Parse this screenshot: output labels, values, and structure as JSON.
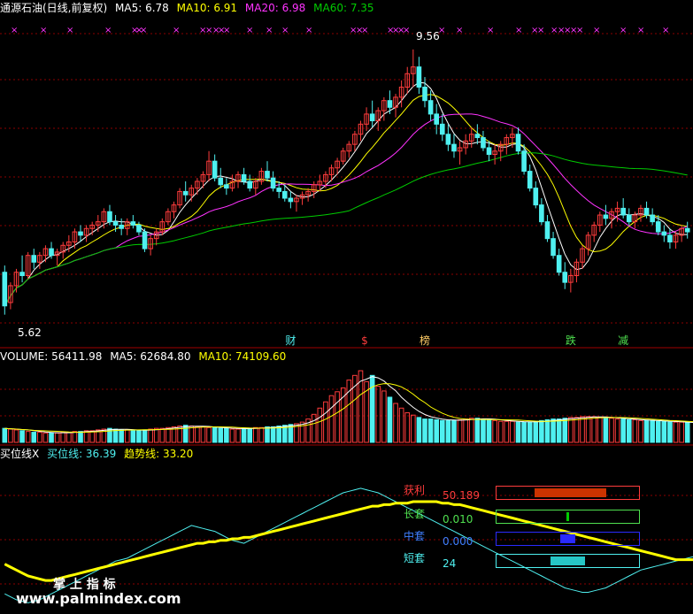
{
  "colors": {
    "up": "#ff3c3c",
    "down": "#4ff0f0",
    "ma5": "#ffffff",
    "ma10": "#ffff00",
    "ma20": "#ff33ff",
    "ma60": "#00cc00",
    "grid": "#8b0000",
    "divider": "#a00000",
    "xmark": "#ff33ff"
  },
  "price_panel": {
    "title": "通源石油(日线,前复权)",
    "ma5_label": "MA5: 6.78",
    "ma10_label": "MA10: 6.91",
    "ma20_label": "MA20: 6.98",
    "ma60_label": "MA60: 7.35",
    "high_label": "9.56",
    "low_label": "5.62"
  },
  "volume_panel": {
    "volume_label": "VOLUME: 56411.98",
    "ma5_label": "MA5: 62684.80",
    "ma10_label": "MA10: 74109.60"
  },
  "indicator_panel": {
    "name": "买位线X",
    "buy_label": "买位线: 36.39",
    "trend_label": "趋势线: 33.20"
  },
  "signal_markers": [
    {
      "text": "财",
      "color": "#4ff0f0",
      "x_index": 49
    },
    {
      "text": "$",
      "color": "#ff3c3c",
      "x_index": 62
    },
    {
      "text": "榜",
      "color": "#ffcc66",
      "x_index": 72
    },
    {
      "text": "跌",
      "color": "#4fe04f",
      "x_index": 97
    },
    {
      "text": "减",
      "color": "#4fe04f",
      "x_index": 106
    }
  ],
  "indicator_rows": [
    {
      "label": "获利",
      "value": "50.189",
      "label_color": "#ff3c3c",
      "value_color": "#ff3c3c",
      "box_color": "#ff3c3c",
      "fill_color": "#cc3300",
      "fill_from": 0.27,
      "fill_to": 0.77
    },
    {
      "label": "长套",
      "value": "0.010",
      "label_color": "#4fe04f",
      "value_color": "#4fe04f",
      "box_color": "#4fe04f",
      "fill_color": "#00cc00",
      "fill_from": 0.49,
      "fill_to": 0.51
    },
    {
      "label": "中套",
      "value": "0.000",
      "label_color": "#3f7fff",
      "value_color": "#3f7fff",
      "box_color": "#2a2aff",
      "fill_color": "#2a2aff",
      "fill_from": 0.45,
      "fill_to": 0.55
    },
    {
      "label": "短套",
      "value": "24",
      "label_color": "#4ff0f0",
      "value_color": "#4ff0f0",
      "box_color": "#4ff0f0",
      "fill_color": "#26c6c6",
      "fill_from": 0.38,
      "fill_to": 0.62
    }
  ],
  "watermark": {
    "cn": "掌 上 指 标",
    "url": "www.palmindex.com"
  },
  "chart_data": [
    {
      "type": "candlestick",
      "title": "通源石油(日线,前复权)",
      "ylim": [
        5.3,
        9.9
      ],
      "series_names": [
        "MA5",
        "MA10",
        "MA20",
        "MA60"
      ],
      "ohlc": [
        [
          6.25,
          6.35,
          5.62,
          5.75
        ],
        [
          5.8,
          6.1,
          5.7,
          6.05
        ],
        [
          6.05,
          6.3,
          5.95,
          6.25
        ],
        [
          6.25,
          6.5,
          6.1,
          6.2
        ],
        [
          6.2,
          6.55,
          6.15,
          6.5
        ],
        [
          6.5,
          6.6,
          6.3,
          6.4
        ],
        [
          6.4,
          6.55,
          6.3,
          6.5
        ],
        [
          6.5,
          6.65,
          6.4,
          6.6
        ],
        [
          6.6,
          6.7,
          6.45,
          6.5
        ],
        [
          6.5,
          6.6,
          6.35,
          6.55
        ],
        [
          6.55,
          6.7,
          6.45,
          6.65
        ],
        [
          6.65,
          6.8,
          6.55,
          6.7
        ],
        [
          6.7,
          6.9,
          6.6,
          6.85
        ],
        [
          6.85,
          6.95,
          6.7,
          6.8
        ],
        [
          6.8,
          6.95,
          6.7,
          6.9
        ],
        [
          6.9,
          7.0,
          6.8,
          6.95
        ],
        [
          6.95,
          7.1,
          6.85,
          7.0
        ],
        [
          7.0,
          7.2,
          6.9,
          7.15
        ],
        [
          7.15,
          7.25,
          6.95,
          7.0
        ],
        [
          7.0,
          7.1,
          6.85,
          6.95
        ],
        [
          6.95,
          7.05,
          6.8,
          6.9
        ],
        [
          6.9,
          7.05,
          6.8,
          7.0
        ],
        [
          7.0,
          7.1,
          6.9,
          6.95
        ],
        [
          6.95,
          7.0,
          6.8,
          6.85
        ],
        [
          6.85,
          6.9,
          6.55,
          6.6
        ],
        [
          6.6,
          6.8,
          6.5,
          6.75
        ],
        [
          6.75,
          6.9,
          6.65,
          6.85
        ],
        [
          6.85,
          7.05,
          6.8,
          7.0
        ],
        [
          7.0,
          7.2,
          6.95,
          7.15
        ],
        [
          7.15,
          7.3,
          7.05,
          7.25
        ],
        [
          7.25,
          7.5,
          7.2,
          7.45
        ],
        [
          7.45,
          7.6,
          7.3,
          7.4
        ],
        [
          7.4,
          7.55,
          7.3,
          7.5
        ],
        [
          7.5,
          7.65,
          7.4,
          7.6
        ],
        [
          7.6,
          7.75,
          7.5,
          7.7
        ],
        [
          7.7,
          8.05,
          7.6,
          7.9
        ],
        [
          7.9,
          8.0,
          7.6,
          7.65
        ],
        [
          7.65,
          7.8,
          7.5,
          7.55
        ],
        [
          7.55,
          7.65,
          7.4,
          7.5
        ],
        [
          7.5,
          7.7,
          7.45,
          7.6
        ],
        [
          7.6,
          7.75,
          7.5,
          7.7
        ],
        [
          7.7,
          7.8,
          7.55,
          7.6
        ],
        [
          7.6,
          7.7,
          7.45,
          7.5
        ],
        [
          7.5,
          7.65,
          7.4,
          7.6
        ],
        [
          7.6,
          7.8,
          7.55,
          7.75
        ],
        [
          7.75,
          7.9,
          7.6,
          7.65
        ],
        [
          7.65,
          7.75,
          7.45,
          7.5
        ],
        [
          7.5,
          7.6,
          7.35,
          7.45
        ],
        [
          7.45,
          7.55,
          7.3,
          7.35
        ],
        [
          7.35,
          7.45,
          7.2,
          7.3
        ],
        [
          7.3,
          7.4,
          7.15,
          7.35
        ],
        [
          7.35,
          7.45,
          7.25,
          7.4
        ],
        [
          7.4,
          7.5,
          7.3,
          7.45
        ],
        [
          7.45,
          7.6,
          7.35,
          7.55
        ],
        [
          7.55,
          7.7,
          7.45,
          7.6
        ],
        [
          7.6,
          7.75,
          7.5,
          7.7
        ],
        [
          7.7,
          7.85,
          7.6,
          7.8
        ],
        [
          7.8,
          7.95,
          7.7,
          7.9
        ],
        [
          7.9,
          8.1,
          7.85,
          8.05
        ],
        [
          8.05,
          8.2,
          7.95,
          8.15
        ],
        [
          8.15,
          8.35,
          8.05,
          8.3
        ],
        [
          8.3,
          8.5,
          8.2,
          8.45
        ],
        [
          8.45,
          8.7,
          8.35,
          8.6
        ],
        [
          8.6,
          8.8,
          8.4,
          8.5
        ],
        [
          8.5,
          8.7,
          8.35,
          8.65
        ],
        [
          8.65,
          8.85,
          8.5,
          8.8
        ],
        [
          8.8,
          8.95,
          8.6,
          8.7
        ],
        [
          8.7,
          8.9,
          8.55,
          8.85
        ],
        [
          8.85,
          9.1,
          8.7,
          9.0
        ],
        [
          9.0,
          9.3,
          8.9,
          9.2
        ],
        [
          9.2,
          9.56,
          9.0,
          9.3
        ],
        [
          9.3,
          9.45,
          8.9,
          9.0
        ],
        [
          9.0,
          9.15,
          8.7,
          8.8
        ],
        [
          8.8,
          8.95,
          8.5,
          8.6
        ],
        [
          8.6,
          8.75,
          8.3,
          8.45
        ],
        [
          8.45,
          8.6,
          8.2,
          8.3
        ],
        [
          8.3,
          8.45,
          8.05,
          8.15
        ],
        [
          8.15,
          8.3,
          7.95,
          8.05
        ],
        [
          8.05,
          8.2,
          7.85,
          8.1
        ],
        [
          8.1,
          8.3,
          8.0,
          8.2
        ],
        [
          8.2,
          8.4,
          8.1,
          8.3
        ],
        [
          8.3,
          8.45,
          8.15,
          8.25
        ],
        [
          8.25,
          8.35,
          8.05,
          8.1
        ],
        [
          8.1,
          8.2,
          7.9,
          8.0
        ],
        [
          8.0,
          8.15,
          7.85,
          8.05
        ],
        [
          8.05,
          8.2,
          7.9,
          8.15
        ],
        [
          8.15,
          8.3,
          8.0,
          8.25
        ],
        [
          8.25,
          8.4,
          8.1,
          8.3
        ],
        [
          8.3,
          8.4,
          8.0,
          8.05
        ],
        [
          8.05,
          8.15,
          7.7,
          7.75
        ],
        [
          7.75,
          7.85,
          7.45,
          7.5
        ],
        [
          7.5,
          7.6,
          7.2,
          7.25
        ],
        [
          7.25,
          7.35,
          6.95,
          7.0
        ],
        [
          7.0,
          7.1,
          6.7,
          6.75
        ],
        [
          6.75,
          6.85,
          6.45,
          6.5
        ],
        [
          6.5,
          6.6,
          6.2,
          6.25
        ],
        [
          6.25,
          6.4,
          6.0,
          6.1
        ],
        [
          6.1,
          6.3,
          5.95,
          6.2
        ],
        [
          6.2,
          6.45,
          6.1,
          6.4
        ],
        [
          6.4,
          6.65,
          6.3,
          6.6
        ],
        [
          6.6,
          6.85,
          6.5,
          6.8
        ],
        [
          6.8,
          7.0,
          6.7,
          6.95
        ],
        [
          6.95,
          7.15,
          6.85,
          7.1
        ],
        [
          7.1,
          7.25,
          6.95,
          7.05
        ],
        [
          7.05,
          7.2,
          6.9,
          7.15
        ],
        [
          7.15,
          7.3,
          7.0,
          7.2
        ],
        [
          7.2,
          7.35,
          7.05,
          7.1
        ],
        [
          7.1,
          7.2,
          6.95,
          7.0
        ],
        [
          7.0,
          7.15,
          6.9,
          7.1
        ],
        [
          7.1,
          7.25,
          7.0,
          7.2
        ],
        [
          7.2,
          7.3,
          7.05,
          7.1
        ],
        [
          7.1,
          7.2,
          6.95,
          7.0
        ],
        [
          7.0,
          7.1,
          6.8,
          6.85
        ],
        [
          6.85,
          6.95,
          6.7,
          6.8
        ],
        [
          6.8,
          6.9,
          6.6,
          6.7
        ],
        [
          6.7,
          6.85,
          6.6,
          6.8
        ],
        [
          6.8,
          6.95,
          6.7,
          6.9
        ],
        [
          6.9,
          7.0,
          6.75,
          6.85
        ]
      ]
    },
    {
      "type": "bar",
      "title": "VOLUME",
      "ylim": [
        0,
        100
      ],
      "values": [
        18,
        17,
        16,
        15,
        14,
        13,
        13,
        12,
        12,
        12,
        13,
        13,
        14,
        14,
        15,
        15,
        16,
        17,
        18,
        17,
        16,
        16,
        15,
        15,
        16,
        17,
        18,
        18,
        19,
        20,
        21,
        22,
        21,
        20,
        20,
        19,
        19,
        18,
        18,
        17,
        17,
        18,
        18,
        19,
        19,
        20,
        20,
        21,
        22,
        23,
        24,
        26,
        30,
        36,
        44,
        52,
        60,
        65,
        70,
        80,
        86,
        92,
        78,
        86,
        72,
        66,
        58,
        50,
        44,
        38,
        35,
        32,
        30,
        30,
        29,
        28,
        28,
        28,
        29,
        30,
        31,
        31,
        30,
        29,
        28,
        27,
        27,
        27,
        26,
        26,
        26,
        27,
        28,
        29,
        30,
        30,
        31,
        32,
        32,
        33,
        33,
        33,
        32,
        32,
        31,
        30,
        30,
        29,
        29,
        28,
        28,
        28,
        27,
        27,
        26,
        26,
        26,
        25,
        25,
        25
      ]
    },
    {
      "type": "line",
      "title": "买位线X",
      "ylim": [
        0,
        100
      ],
      "series": [
        {
          "name": "买位线",
          "values": [
            10,
            8,
            6,
            5,
            4,
            5,
            6,
            8,
            10,
            12,
            14,
            16,
            18,
            20,
            22,
            24,
            26,
            28,
            30,
            32,
            33,
            34,
            36,
            38,
            40,
            42,
            44,
            46,
            48,
            50,
            52,
            54,
            56,
            55,
            54,
            53,
            52,
            50,
            48,
            46,
            45,
            44,
            46,
            48,
            50,
            52,
            54,
            56,
            58,
            60,
            62,
            64,
            66,
            68,
            70,
            72,
            74,
            76,
            78,
            79,
            80,
            81,
            80,
            79,
            78,
            76,
            74,
            72,
            70,
            68,
            66,
            64,
            62,
            60,
            58,
            56,
            54,
            52,
            50,
            48,
            46,
            44,
            42,
            40,
            38,
            36,
            34,
            32,
            30,
            28,
            26,
            24,
            22,
            20,
            18,
            16,
            14,
            13,
            12,
            11,
            11,
            12,
            13,
            14,
            16,
            18,
            20,
            22,
            24,
            26,
            27,
            28,
            29,
            30,
            31,
            32,
            33,
            34,
            35,
            36
          ]
        },
        {
          "name": "趋势线",
          "values": [
            30,
            28,
            26,
            24,
            22,
            21,
            20,
            19,
            19,
            20,
            21,
            22,
            23,
            24,
            25,
            26,
            27,
            28,
            29,
            30,
            31,
            32,
            33,
            34,
            35,
            36,
            37,
            38,
            39,
            40,
            41,
            42,
            43,
            44,
            44,
            45,
            45,
            46,
            46,
            47,
            47,
            48,
            48,
            49,
            50,
            51,
            52,
            53,
            54,
            55,
            56,
            57,
            58,
            59,
            60,
            61,
            62,
            63,
            64,
            65,
            66,
            67,
            68,
            69,
            69,
            70,
            70,
            71,
            71,
            71,
            72,
            72,
            72,
            72,
            72,
            71,
            71,
            70,
            70,
            69,
            68,
            67,
            66,
            65,
            64,
            63,
            62,
            61,
            60,
            59,
            58,
            57,
            56,
            55,
            54,
            53,
            52,
            51,
            50,
            49,
            48,
            47,
            46,
            45,
            44,
            43,
            42,
            41,
            40,
            39,
            38,
            37,
            36,
            35,
            34,
            33,
            33,
            33,
            33,
            33
          ]
        }
      ]
    }
  ]
}
